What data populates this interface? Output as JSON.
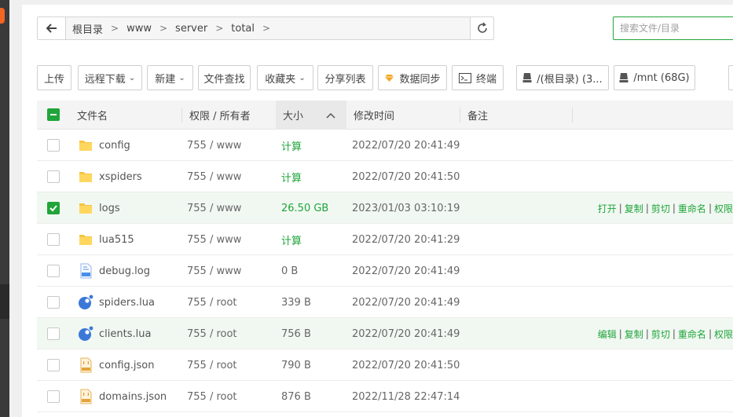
{
  "path": {
    "crumbs": [
      "根目录",
      "www",
      "server",
      "total"
    ]
  },
  "search": {
    "placeholder": "搜索文件/目录"
  },
  "toolbar": {
    "upload": "上传",
    "remote_download": "远程下载",
    "new": "新建",
    "file_search": "文件查找",
    "favorites": "收藏夹",
    "share_list": "分享列表",
    "data_sync": "数据同步",
    "terminal": "终端",
    "disk_root": "/(根目录) (3...",
    "disk_mnt": "/mnt (68G)"
  },
  "columns": {
    "name": "文件名",
    "perm": "权限 / 所有者",
    "size": "大小",
    "mtime": "修改时间",
    "note": "备注"
  },
  "rows": [
    {
      "name": "config",
      "type": "folder",
      "perm": "755 / www",
      "size": "计算",
      "mtime": "2022/07/20 20:41:49",
      "checked": false
    },
    {
      "name": "xspiders",
      "type": "folder",
      "perm": "755 / www",
      "size": "计算",
      "mtime": "2022/07/20 20:41:50",
      "checked": false
    },
    {
      "name": "logs",
      "type": "folder",
      "perm": "755 / www",
      "size": "26.50 GB",
      "mtime": "2023/01/03 03:10:19",
      "checked": true,
      "ops": [
        "打开",
        "复制",
        "剪切",
        "重命名",
        "权限"
      ]
    },
    {
      "name": "lua515",
      "type": "folder",
      "perm": "755 / www",
      "size": "计算",
      "mtime": "2022/07/20 20:41:29",
      "checked": false
    },
    {
      "name": "debug.log",
      "type": "log",
      "perm": "755 / www",
      "size": "0 B",
      "mtime": "2022/07/20 20:41:49",
      "checked": false
    },
    {
      "name": "spiders.lua",
      "type": "lua",
      "perm": "755 / root",
      "size": "339 B",
      "mtime": "2022/07/20 20:41:49",
      "checked": false
    },
    {
      "name": "clients.lua",
      "type": "lua",
      "perm": "755 / root",
      "size": "756 B",
      "mtime": "2022/07/20 20:41:49",
      "checked": false,
      "ops": [
        "编辑",
        "复制",
        "剪切",
        "重命名",
        "权限"
      ]
    },
    {
      "name": "config.json",
      "type": "json",
      "perm": "755 / root",
      "size": "790 B",
      "mtime": "2022/07/20 20:41:50",
      "checked": false
    },
    {
      "name": "domains.json",
      "type": "json",
      "perm": "755 / root",
      "size": "876 B",
      "mtime": "2022/11/28 22:47:14",
      "checked": false
    }
  ],
  "colors": {
    "accent": "#20a53a",
    "brand_orange": "#f26522"
  }
}
